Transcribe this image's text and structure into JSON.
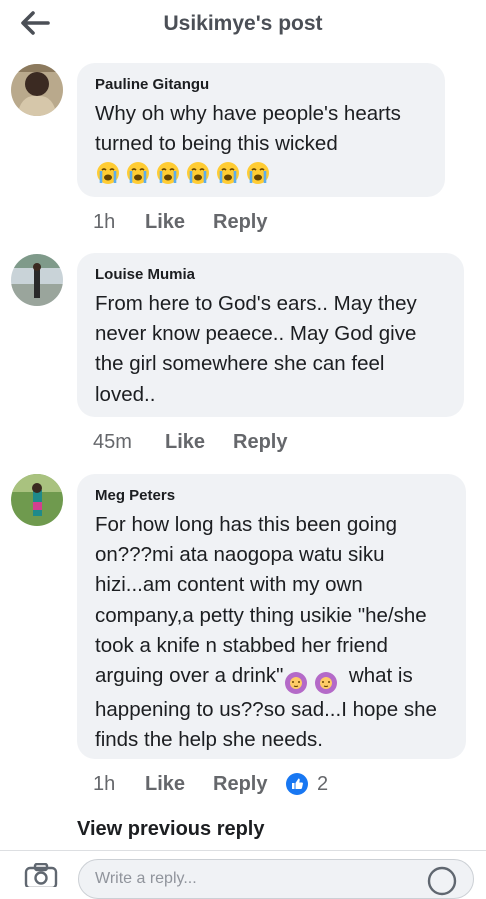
{
  "header": {
    "title": "Usikimye's post"
  },
  "comments": [
    {
      "author": "Pauline Gitangu",
      "text": "Why oh why have people's hearts turned to being this wicked",
      "emoji_count": 6,
      "time": "1h",
      "like": "Like",
      "reply": "Reply"
    },
    {
      "author": "Louise Mumia",
      "text": "From here to God's ears.. May they never know peaece.. May God give the girl somewhere she can feel loved..",
      "time": "45m",
      "like": "Like",
      "reply": "Reply"
    },
    {
      "author": "Meg Peters",
      "text_part1": "For how long has this been going on???mi ata naogopa watu siku hizi...am content with my own company,a petty thing usikie \"he/she took a knife n stabbed her friend arguing over a drink\"",
      "text_part2": "what is happening to us??so sad...I hope she finds the help she needs.",
      "emoji_count": 2,
      "time": "1h",
      "like": "Like",
      "reply": "Reply",
      "reaction_count": "2"
    }
  ],
  "view_previous": "View previous reply",
  "composer": {
    "placeholder": "Write a reply..."
  },
  "colors": {
    "accent": "#1877f2",
    "bubble": "#f0f2f5",
    "meta": "#65676b"
  },
  "icons": {
    "back": "arrow-left-icon",
    "crying": "loudly-crying-face-emoji",
    "facepalm": "person-gesturing-no-emoji",
    "like_reaction": "thumbs-up-icon",
    "camera": "camera-icon",
    "smiley": "smiley-icon"
  }
}
